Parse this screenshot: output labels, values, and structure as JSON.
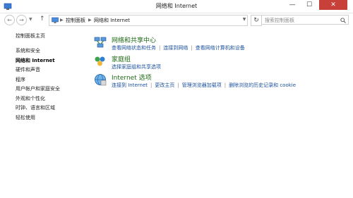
{
  "window": {
    "title": "网络和 Internet",
    "minimize": "—",
    "maximize": "☐",
    "close": "✕"
  },
  "nav": {
    "back": "←",
    "forward": "→",
    "up": "↑"
  },
  "address": {
    "crumbs": [
      "控制面板",
      "网络和 Internet"
    ]
  },
  "search": {
    "placeholder": "搜索控制面板"
  },
  "sidebar": {
    "items": [
      {
        "label": "控制面板主页",
        "active": false
      },
      {
        "label": "系统和安全",
        "active": false
      },
      {
        "label": "网络和 Internet",
        "active": true
      },
      {
        "label": "硬件和声音",
        "active": false
      },
      {
        "label": "程序",
        "active": false
      },
      {
        "label": "用户帐户和家庭安全",
        "active": false
      },
      {
        "label": "外观和个性化",
        "active": false
      },
      {
        "label": "时钟、语言和区域",
        "active": false
      },
      {
        "label": "轻松使用",
        "active": false
      }
    ]
  },
  "groups": [
    {
      "title": "网络和共享中心",
      "icon": "network-sharing-icon",
      "links": [
        "查看网络状态和任务",
        "连接到网络",
        "查看网络计算机和设备"
      ]
    },
    {
      "title": "家庭组",
      "icon": "homegroup-icon",
      "links": [
        "选择家庭组和共享选项"
      ]
    },
    {
      "title": "Internet 选项",
      "icon": "internet-options-icon",
      "links": [
        "连接到 Internet",
        "更改主页",
        "管理浏览器加载项",
        "删除浏览的历史记录和 cookie"
      ]
    }
  ]
}
